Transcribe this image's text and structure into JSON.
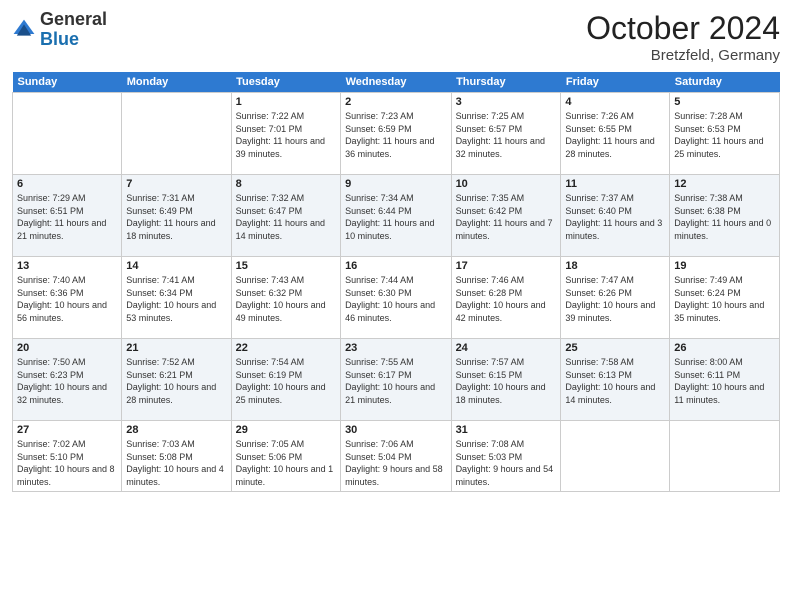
{
  "header": {
    "logo_general": "General",
    "logo_blue": "Blue",
    "month_title": "October 2024",
    "location": "Bretzfeld, Germany"
  },
  "days_of_week": [
    "Sunday",
    "Monday",
    "Tuesday",
    "Wednesday",
    "Thursday",
    "Friday",
    "Saturday"
  ],
  "weeks": [
    [
      {
        "day": "",
        "info": ""
      },
      {
        "day": "",
        "info": ""
      },
      {
        "day": "1",
        "info": "Sunrise: 7:22 AM\nSunset: 7:01 PM\nDaylight: 11 hours and 39 minutes."
      },
      {
        "day": "2",
        "info": "Sunrise: 7:23 AM\nSunset: 6:59 PM\nDaylight: 11 hours and 36 minutes."
      },
      {
        "day": "3",
        "info": "Sunrise: 7:25 AM\nSunset: 6:57 PM\nDaylight: 11 hours and 32 minutes."
      },
      {
        "day": "4",
        "info": "Sunrise: 7:26 AM\nSunset: 6:55 PM\nDaylight: 11 hours and 28 minutes."
      },
      {
        "day": "5",
        "info": "Sunrise: 7:28 AM\nSunset: 6:53 PM\nDaylight: 11 hours and 25 minutes."
      }
    ],
    [
      {
        "day": "6",
        "info": "Sunrise: 7:29 AM\nSunset: 6:51 PM\nDaylight: 11 hours and 21 minutes."
      },
      {
        "day": "7",
        "info": "Sunrise: 7:31 AM\nSunset: 6:49 PM\nDaylight: 11 hours and 18 minutes."
      },
      {
        "day": "8",
        "info": "Sunrise: 7:32 AM\nSunset: 6:47 PM\nDaylight: 11 hours and 14 minutes."
      },
      {
        "day": "9",
        "info": "Sunrise: 7:34 AM\nSunset: 6:44 PM\nDaylight: 11 hours and 10 minutes."
      },
      {
        "day": "10",
        "info": "Sunrise: 7:35 AM\nSunset: 6:42 PM\nDaylight: 11 hours and 7 minutes."
      },
      {
        "day": "11",
        "info": "Sunrise: 7:37 AM\nSunset: 6:40 PM\nDaylight: 11 hours and 3 minutes."
      },
      {
        "day": "12",
        "info": "Sunrise: 7:38 AM\nSunset: 6:38 PM\nDaylight: 11 hours and 0 minutes."
      }
    ],
    [
      {
        "day": "13",
        "info": "Sunrise: 7:40 AM\nSunset: 6:36 PM\nDaylight: 10 hours and 56 minutes."
      },
      {
        "day": "14",
        "info": "Sunrise: 7:41 AM\nSunset: 6:34 PM\nDaylight: 10 hours and 53 minutes."
      },
      {
        "day": "15",
        "info": "Sunrise: 7:43 AM\nSunset: 6:32 PM\nDaylight: 10 hours and 49 minutes."
      },
      {
        "day": "16",
        "info": "Sunrise: 7:44 AM\nSunset: 6:30 PM\nDaylight: 10 hours and 46 minutes."
      },
      {
        "day": "17",
        "info": "Sunrise: 7:46 AM\nSunset: 6:28 PM\nDaylight: 10 hours and 42 minutes."
      },
      {
        "day": "18",
        "info": "Sunrise: 7:47 AM\nSunset: 6:26 PM\nDaylight: 10 hours and 39 minutes."
      },
      {
        "day": "19",
        "info": "Sunrise: 7:49 AM\nSunset: 6:24 PM\nDaylight: 10 hours and 35 minutes."
      }
    ],
    [
      {
        "day": "20",
        "info": "Sunrise: 7:50 AM\nSunset: 6:23 PM\nDaylight: 10 hours and 32 minutes."
      },
      {
        "day": "21",
        "info": "Sunrise: 7:52 AM\nSunset: 6:21 PM\nDaylight: 10 hours and 28 minutes."
      },
      {
        "day": "22",
        "info": "Sunrise: 7:54 AM\nSunset: 6:19 PM\nDaylight: 10 hours and 25 minutes."
      },
      {
        "day": "23",
        "info": "Sunrise: 7:55 AM\nSunset: 6:17 PM\nDaylight: 10 hours and 21 minutes."
      },
      {
        "day": "24",
        "info": "Sunrise: 7:57 AM\nSunset: 6:15 PM\nDaylight: 10 hours and 18 minutes."
      },
      {
        "day": "25",
        "info": "Sunrise: 7:58 AM\nSunset: 6:13 PM\nDaylight: 10 hours and 14 minutes."
      },
      {
        "day": "26",
        "info": "Sunrise: 8:00 AM\nSunset: 6:11 PM\nDaylight: 10 hours and 11 minutes."
      }
    ],
    [
      {
        "day": "27",
        "info": "Sunrise: 7:02 AM\nSunset: 5:10 PM\nDaylight: 10 hours and 8 minutes."
      },
      {
        "day": "28",
        "info": "Sunrise: 7:03 AM\nSunset: 5:08 PM\nDaylight: 10 hours and 4 minutes."
      },
      {
        "day": "29",
        "info": "Sunrise: 7:05 AM\nSunset: 5:06 PM\nDaylight: 10 hours and 1 minute."
      },
      {
        "day": "30",
        "info": "Sunrise: 7:06 AM\nSunset: 5:04 PM\nDaylight: 9 hours and 58 minutes."
      },
      {
        "day": "31",
        "info": "Sunrise: 7:08 AM\nSunset: 5:03 PM\nDaylight: 9 hours and 54 minutes."
      },
      {
        "day": "",
        "info": ""
      },
      {
        "day": "",
        "info": ""
      }
    ]
  ]
}
